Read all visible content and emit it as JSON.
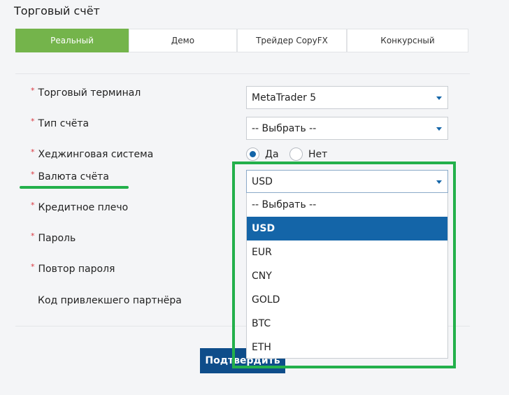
{
  "page_title": "Торговый счёт",
  "tabs": [
    {
      "label": "Реальный",
      "active": true
    },
    {
      "label": "Демо",
      "active": false
    },
    {
      "label": "Трейдер CopyFX",
      "active": false
    },
    {
      "label": "Конкурсный",
      "active": false
    }
  ],
  "fields": {
    "terminal": {
      "label": "Торговый терминал",
      "value": "MetaTrader 5"
    },
    "account_type": {
      "label": "Тип счёта",
      "value": "-- Выбрать --"
    },
    "hedging": {
      "label": "Хеджинговая система",
      "option_yes": "Да",
      "option_no": "Нет",
      "selected": "Да"
    },
    "currency": {
      "label": "Валюта счёта",
      "value": "USD",
      "options": [
        "-- Выбрать --",
        "USD",
        "EUR",
        "CNY",
        "GOLD",
        "BTC",
        "ETH"
      ],
      "selected_index": 1
    },
    "leverage": {
      "label": "Кредитное плечо"
    },
    "password": {
      "label": "Пароль"
    },
    "password_repeat": {
      "label": "Повтор пароля"
    },
    "partner_code": {
      "label": "Код привлекшего партнёра"
    }
  },
  "submit_label": "Подтвердить",
  "colors": {
    "accent_green": "#74b44b",
    "primary_blue": "#1465a8",
    "button_blue": "#0e4d8a",
    "annotation_green": "#23b04b",
    "required_star": "#d9363e"
  }
}
